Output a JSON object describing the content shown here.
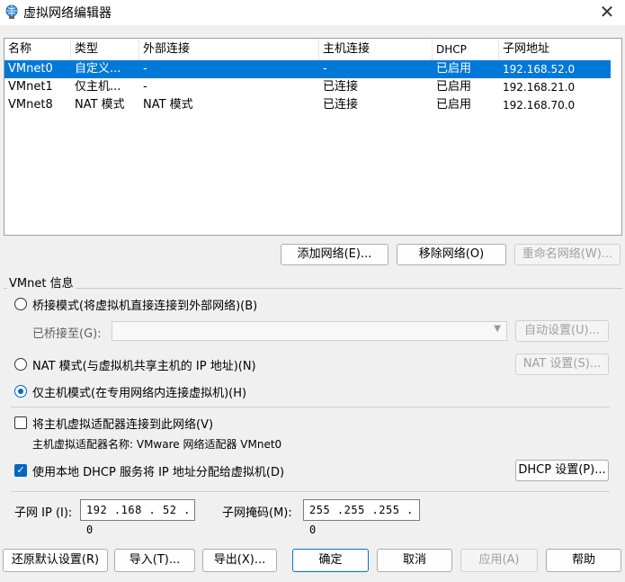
{
  "window": {
    "title": "虚拟网络编辑器",
    "close": "✕"
  },
  "table": {
    "headers": [
      "名称",
      "类型",
      "外部连接",
      "主机连接",
      "DHCP",
      "子网地址"
    ],
    "rows": [
      [
        "VMnet0",
        "自定义...",
        "-",
        "-",
        "已启用",
        "192.168.52.0"
      ],
      [
        "VMnet1",
        "仅主机...",
        "-",
        "已连接",
        "已启用",
        "192.168.21.0"
      ],
      [
        "VMnet8",
        "NAT 模式",
        "NAT 模式",
        "已连接",
        "已启用",
        "192.168.70.0"
      ]
    ]
  },
  "network_buttons": {
    "add": "添加网络(E)...",
    "remove": "移除网络(O)",
    "rename": "重命名网络(W)..."
  },
  "vmnet_info": {
    "title": "VMnet 信息",
    "bridged_label": "桥接模式(将虚拟机直接连接到外部网络)(B)",
    "bridged_to_label": "已桥接至(G):",
    "bridged_to_value": "",
    "auto_settings": "自动设置(U)...",
    "nat_label": "NAT 模式(与虚拟机共享主机的 IP 地址)(N)",
    "nat_settings": "NAT 设置(S)...",
    "hostonly_label": "仅主机模式(在专用网络内连接虚拟机)(H)",
    "selected_mode": "hostonly",
    "connect_adapter_label": "将主机虚拟适配器连接到此网络(V)",
    "connect_adapter_checked": false,
    "adapter_name_label": "主机虚拟适配器名称: VMware 网络适配器 VMnet0",
    "dhcp_label": "使用本地 DHCP 服务将 IP 地址分配给虚拟机(D)",
    "dhcp_checked": true,
    "dhcp_settings": "DHCP 设置(P)...",
    "subnet_ip_label": "子网 IP (I):",
    "subnet_ip_value": "192 .168 . 52  .  0",
    "subnet_mask_label": "子网掩码(M):",
    "subnet_mask_value": "255 .255 .255 .  0"
  },
  "footer": {
    "restore": "还原默认设置(R)",
    "import": "导入(T)...",
    "export": "导出(X)...",
    "ok": "确定",
    "cancel": "取消",
    "apply": "应用(A)",
    "help": "帮助"
  },
  "colors": {
    "selection": "#0078d7",
    "accent": "#0067c0"
  }
}
